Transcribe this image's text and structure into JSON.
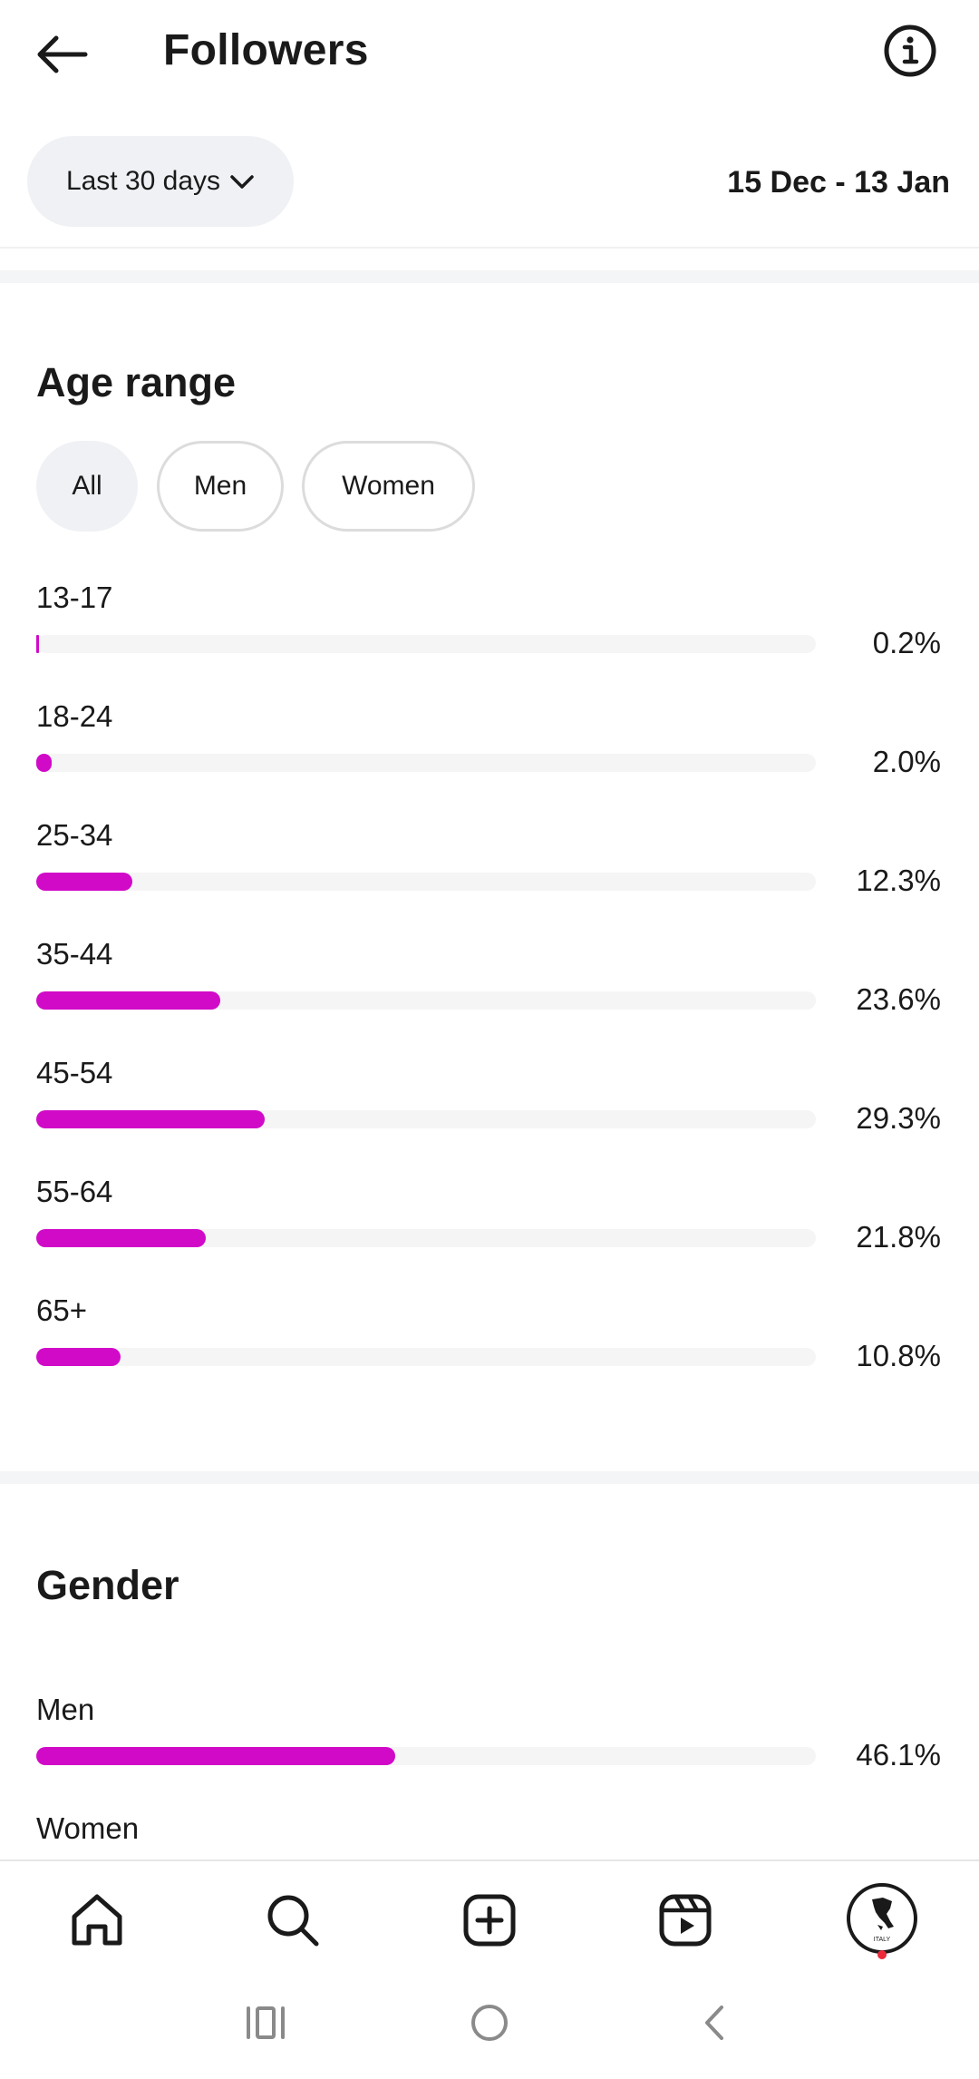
{
  "header": {
    "title": "Followers"
  },
  "filters": {
    "range_label": "Last 30 days",
    "date_range": "15 Dec - 13 Jan"
  },
  "age_range": {
    "title": "Age range",
    "chips": [
      "All",
      "Men",
      "Women"
    ],
    "selected_chip": "All",
    "rows": [
      {
        "label": "13-17",
        "value": 0.2,
        "display": "0.2%"
      },
      {
        "label": "18-24",
        "value": 2.0,
        "display": "2.0%"
      },
      {
        "label": "25-34",
        "value": 12.3,
        "display": "12.3%"
      },
      {
        "label": "35-44",
        "value": 23.6,
        "display": "23.6%"
      },
      {
        "label": "45-54",
        "value": 29.3,
        "display": "29.3%"
      },
      {
        "label": "55-64",
        "value": 21.8,
        "display": "21.8%"
      },
      {
        "label": "65+",
        "value": 10.8,
        "display": "10.8%"
      }
    ]
  },
  "gender": {
    "title": "Gender",
    "rows": [
      {
        "label": "Men",
        "value": 46.1,
        "display": "46.1%"
      },
      {
        "label": "Women",
        "value": null,
        "display": ""
      }
    ]
  },
  "bar_color": "#d10ac8",
  "bottom_nav": {
    "items": [
      "home-icon",
      "search-icon",
      "create-icon",
      "reels-icon",
      "profile-avatar"
    ],
    "avatar_text": "ITALY"
  },
  "system_nav": [
    "recent-apps-icon",
    "home-button-icon",
    "back-icon"
  ]
}
